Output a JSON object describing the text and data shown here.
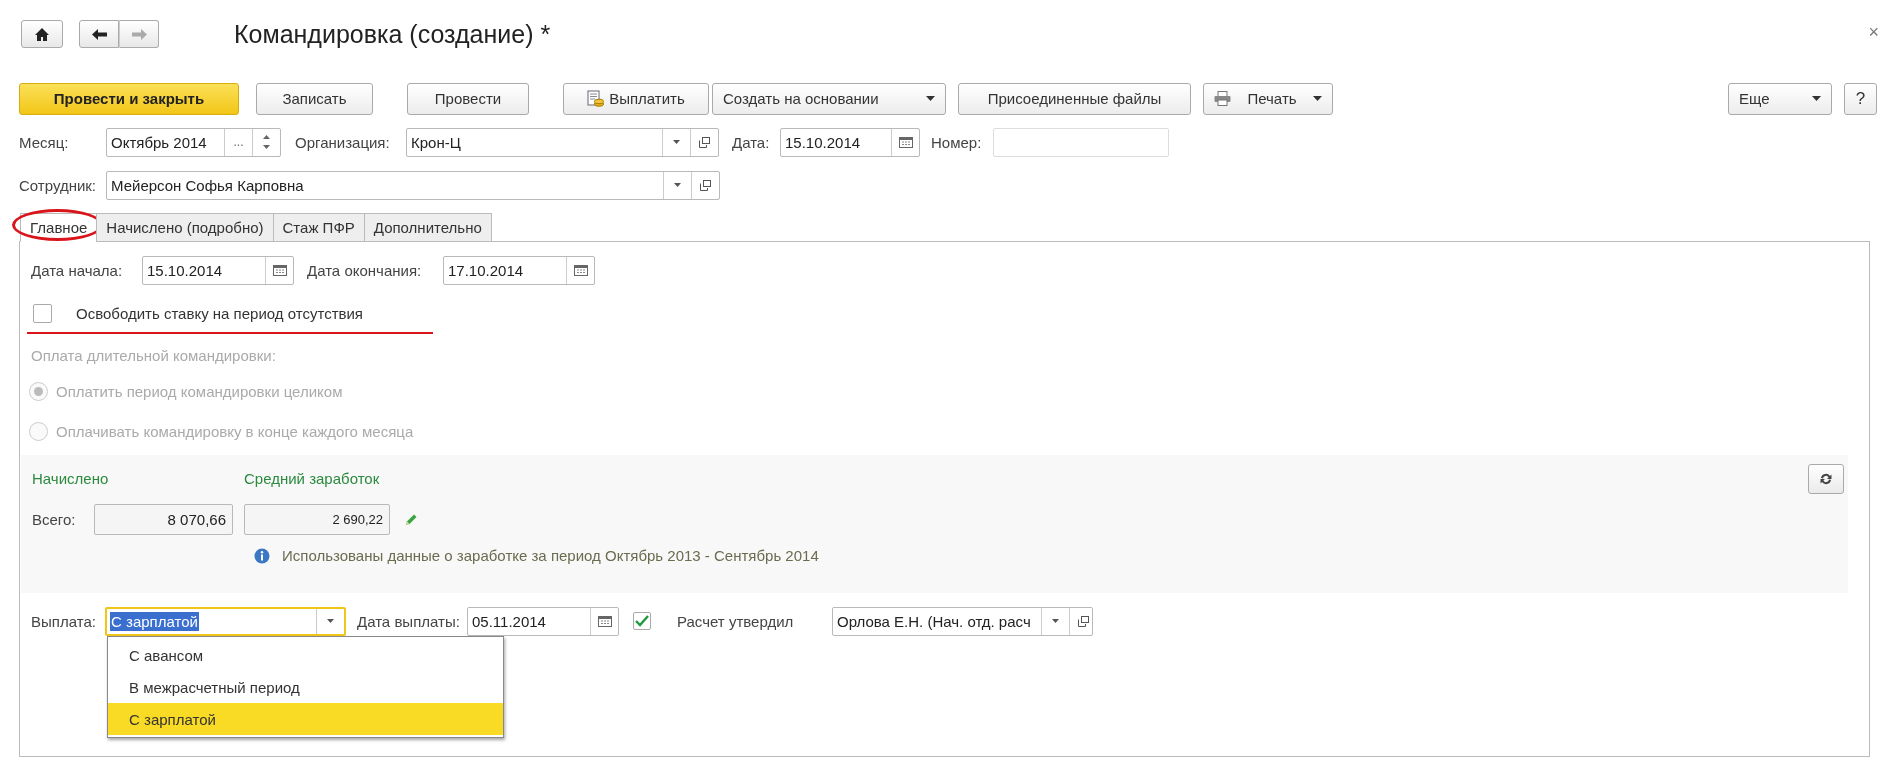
{
  "window": {
    "title": "Командировка (создание) *",
    "close": "×"
  },
  "toolbar": {
    "buttons": [
      {
        "label": "Провести и закрыть",
        "kind": "primary"
      },
      {
        "label": "Записать",
        "kind": "plain"
      },
      {
        "label": "Провести",
        "kind": "plain"
      },
      {
        "label": "Выплатить",
        "kind": "pay"
      },
      {
        "label": "Создать на основании",
        "kind": "menu"
      },
      {
        "label": "Присоединенные файлы",
        "kind": "plain"
      },
      {
        "label": "Печать",
        "kind": "print"
      }
    ],
    "right_buttons": [
      {
        "label": "Еще",
        "kind": "menu"
      },
      {
        "label": "?",
        "kind": "plain"
      }
    ]
  },
  "header": {
    "month": {
      "label": "Месяц:",
      "value": "Октябрь 2014",
      "select": "..."
    },
    "organization": {
      "label": "Организация:",
      "value": "Крон-Ц"
    },
    "date": {
      "label": "Дата:",
      "value": "15.10.2014"
    },
    "number": {
      "label": "Номер:"
    },
    "employee": {
      "label": "Сотрудник:",
      "value": "Мейерсон Софья Карповна"
    }
  },
  "tabs": [
    {
      "label": "Главное",
      "selected": true
    },
    {
      "label": "Начислено (подробно)",
      "selected": false
    },
    {
      "label": "Стаж ПФР",
      "selected": false
    },
    {
      "label": "Дополнительно",
      "selected": false
    }
  ],
  "main": {
    "start_date": {
      "label": "Дата начала:",
      "value": "15.10.2014"
    },
    "end_date": {
      "label": "Дата окончания:",
      "value": "17.10.2014"
    },
    "free_rate": {
      "label": "Освободить ставку на период отсутствия",
      "checked": false
    },
    "long_trip": {
      "label": "Оплата длительной командировки:",
      "disabled": true,
      "options": [
        {
          "label": "Оплатить период командировки целиком",
          "selected": true
        },
        {
          "label": "Оплачивать командировку в конце каждого месяца",
          "selected": false
        }
      ]
    },
    "accrued": {
      "heading": "Начислено",
      "total_label": "Всего:",
      "total": "8 070,66"
    },
    "average": {
      "heading": "Средний заработок",
      "value": "2 690,22"
    },
    "info": "Использованы данные о заработке за период Октябрь 2013 - Сентябрь 2014"
  },
  "payout": {
    "label": "Выплата:",
    "value": "С зарплатой",
    "date": {
      "label": "Дата выплаты:",
      "value": "05.11.2014"
    },
    "approved": {
      "checked": true,
      "label": "Расчет утвердил"
    },
    "approver": "Орлова Е.Н. (Нач. отд. расч",
    "options": [
      {
        "label": "С авансом",
        "selected": false
      },
      {
        "label": "В межрасчетный период",
        "selected": false
      },
      {
        "label": "С зарплатой",
        "selected": true
      }
    ]
  }
}
